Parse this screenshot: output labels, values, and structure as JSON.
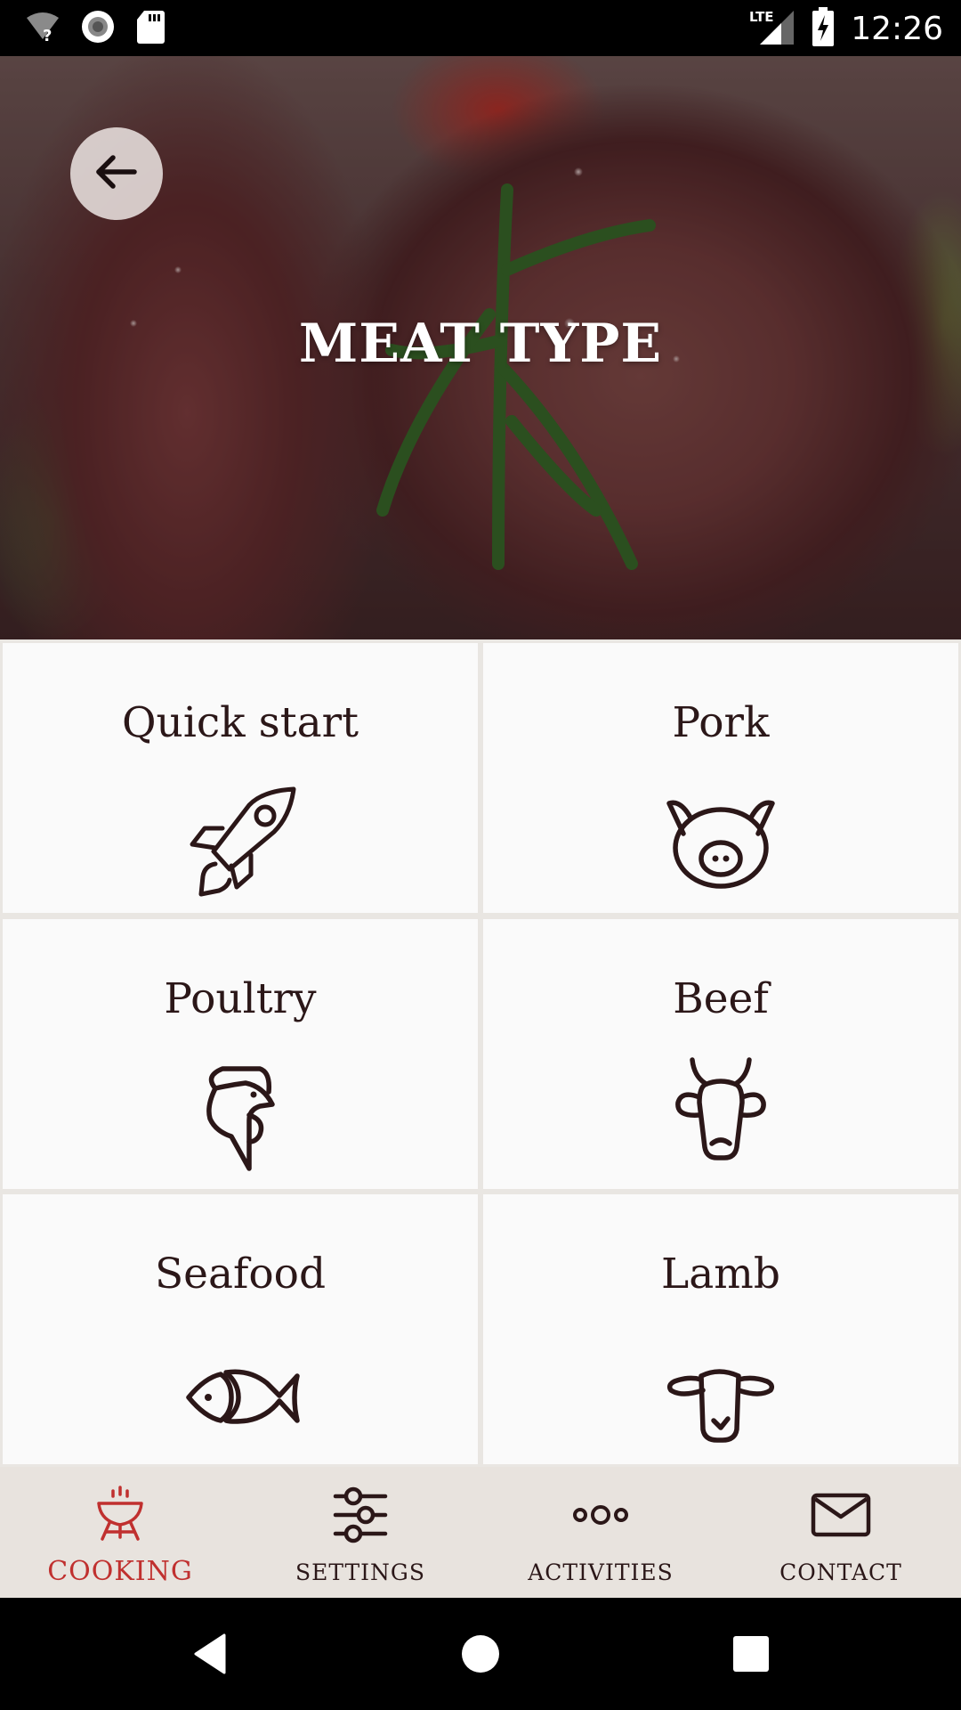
{
  "status_bar": {
    "time": "12:26",
    "network_label": "LTE",
    "icons": [
      "wifi-unknown-icon",
      "record-icon",
      "sd-card-icon",
      "lte-signal-icon",
      "battery-charging-icon"
    ]
  },
  "hero": {
    "title": "MEAT TYPE",
    "back_button_icon": "arrow-left-icon"
  },
  "tiles": [
    {
      "label": "Quick start",
      "icon": "rocket-icon"
    },
    {
      "label": "Pork",
      "icon": "pig-icon"
    },
    {
      "label": "Poultry",
      "icon": "rooster-icon"
    },
    {
      "label": "Beef",
      "icon": "cow-icon"
    },
    {
      "label": "Seafood",
      "icon": "fish-icon"
    },
    {
      "label": "Lamb",
      "icon": "lamb-icon"
    }
  ],
  "bottom_nav": {
    "active_index": 0,
    "items": [
      {
        "label": "COOKING",
        "icon": "grill-icon"
      },
      {
        "label": "SETTINGS",
        "icon": "sliders-icon"
      },
      {
        "label": "ACTIVITIES",
        "icon": "dots-icon"
      },
      {
        "label": "CONTACT",
        "icon": "envelope-icon"
      }
    ]
  },
  "colors": {
    "accent": "#c0302f",
    "text_dark": "#2b1718",
    "tile_bg": "#fafafa",
    "grid_gap": "#e9e6e2",
    "nav_bg": "#e8e3de"
  }
}
